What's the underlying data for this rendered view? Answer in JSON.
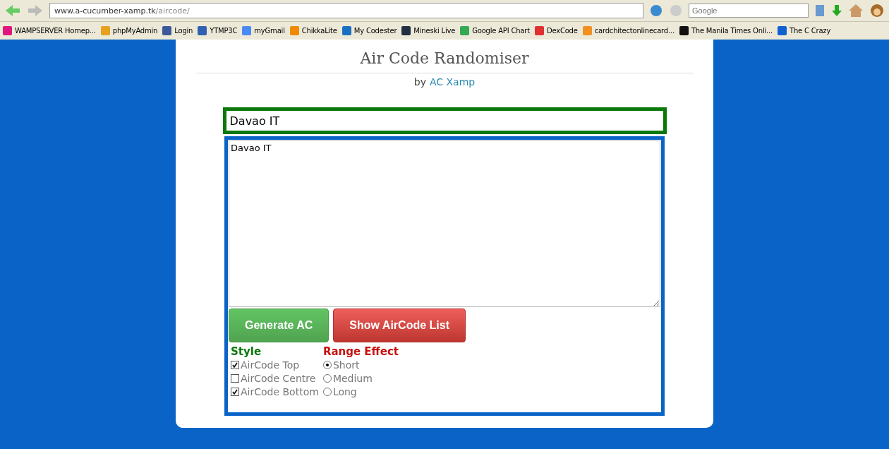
{
  "browser": {
    "url_host": "www.a-cucumber-xamp.tk",
    "url_path": "/aircode/",
    "search_placeholder": "Google"
  },
  "bookmarks": [
    {
      "label": "WAMPSERVER Homep...",
      "color": "#e0157d"
    },
    {
      "label": "phpMyAdmin",
      "color": "#e8a020"
    },
    {
      "label": "Login",
      "color": "#3b5998"
    },
    {
      "label": "YTMP3C",
      "color": "#3060b0"
    },
    {
      "label": "myGmail",
      "color": "#4a8af4"
    },
    {
      "label": "ChikkaLite",
      "color": "#f08a00"
    },
    {
      "label": "My Codester",
      "color": "#1a70c0"
    },
    {
      "label": "Mineski Live",
      "color": "#203040"
    },
    {
      "label": "Google API Chart",
      "color": "#34a853"
    },
    {
      "label": "DexCode",
      "color": "#e03030"
    },
    {
      "label": "cardchitectonlinecard...",
      "color": "#f09020"
    },
    {
      "label": "The Manila Times Onli...",
      "color": "#111111"
    },
    {
      "label": "The C Crazy",
      "color": "#1060d0"
    }
  ],
  "page": {
    "title": "Air Code Randomiser",
    "byline_prefix": "by",
    "byline_link": "AC Xamp",
    "preview": "Davao IT",
    "textarea_value": "Davao IT",
    "buttons": [
      {
        "label": "Generate AC",
        "kind": "success"
      },
      {
        "label": "Show AirCode List",
        "kind": "danger"
      }
    ],
    "style": {
      "heading": "Style",
      "options": [
        {
          "label": "AirCode Top",
          "checked": true
        },
        {
          "label": "AirCode Centre",
          "checked": false
        },
        {
          "label": "AirCode Bottom",
          "checked": true
        }
      ]
    },
    "range": {
      "heading": "Range Effect",
      "options": [
        {
          "label": "Short",
          "selected": true
        },
        {
          "label": "Medium",
          "selected": false
        },
        {
          "label": "Long",
          "selected": false
        }
      ]
    }
  }
}
